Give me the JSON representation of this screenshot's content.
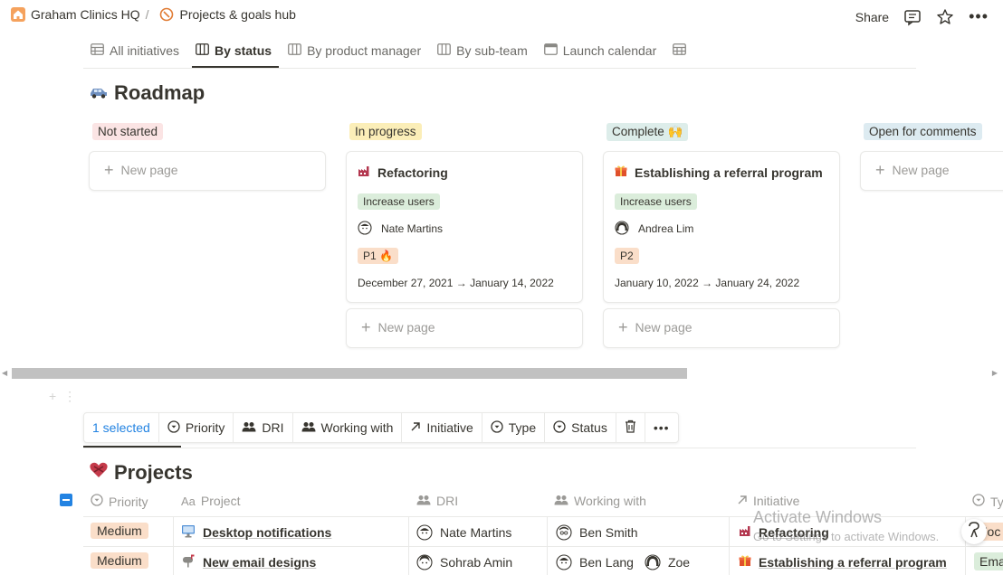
{
  "breadcrumb": {
    "workspace": "Graham Clinics HQ",
    "separator": "/",
    "page": "Projects & goals hub"
  },
  "top_actions": {
    "share": "Share"
  },
  "tabs": [
    {
      "label": "All initiatives",
      "icon": "table-icon",
      "active": false
    },
    {
      "label": "By status",
      "icon": "board-icon",
      "active": true
    },
    {
      "label": "By product manager",
      "icon": "board-icon",
      "active": false
    },
    {
      "label": "By sub-team",
      "icon": "board-icon",
      "active": false
    },
    {
      "label": "Launch calendar",
      "icon": "calendar-icon",
      "active": false
    },
    {
      "label": "",
      "icon": "table-icon",
      "active": false
    }
  ],
  "roadmap": {
    "title": "Roadmap",
    "icon": "car-icon",
    "columns": [
      {
        "label": "Not started",
        "bg": "#fbe4e4",
        "new_page": "New page"
      },
      {
        "label": "In progress",
        "bg": "#fbeeb8",
        "new_page": "New page",
        "card": {
          "title": "Refactoring",
          "tag": "Increase users",
          "person": "Nate Martins",
          "priority": "P1",
          "priority_suffix": "🔥",
          "dates": "December 27, 2021 → January 14, 2022"
        }
      },
      {
        "label": "Complete",
        "suffix": "🙌",
        "bg": "#ddedea",
        "new_page": "New page",
        "card": {
          "title": "Establishing a referral program",
          "tag": "Increase users",
          "person": "Andrea Lim",
          "priority": "P2",
          "dates": "January 10, 2022 → January 24, 2022"
        }
      },
      {
        "label": "Open for comments",
        "bg": "#ddebf1",
        "new_page": "New page"
      }
    ]
  },
  "selection_toolbar": {
    "selected": "1 selected",
    "items": [
      "Priority",
      "DRI",
      "Working with",
      "Initiative",
      "Type",
      "Status"
    ]
  },
  "projects": {
    "title": "Projects",
    "columns": [
      "Priority",
      "Project",
      "DRI",
      "Working with",
      "Initiative",
      "Ty"
    ],
    "rows": [
      {
        "priority": "Medium",
        "project": "Desktop notifications",
        "dri": "Nate Martins",
        "working_with": [
          "Ben Smith"
        ],
        "initiative": "Refactoring",
        "type": "Foc"
      },
      {
        "priority": "Medium",
        "project": "New email designs",
        "dri": "Sohrab Amin",
        "working_with": [
          "Ben Lang",
          "Zoe"
        ],
        "initiative": "Establishing a referral program",
        "type": "Ema"
      }
    ]
  },
  "watermark": {
    "line1": "Activate Windows",
    "line2": "Go to Settings to activate Windows."
  },
  "colors": {
    "accent": "#2383e2",
    "medium_tag": "#fadec9",
    "increase_users_tag": "#dbeddb",
    "p1_tag": "#fadec9",
    "p2_tag": "#fadec9"
  }
}
